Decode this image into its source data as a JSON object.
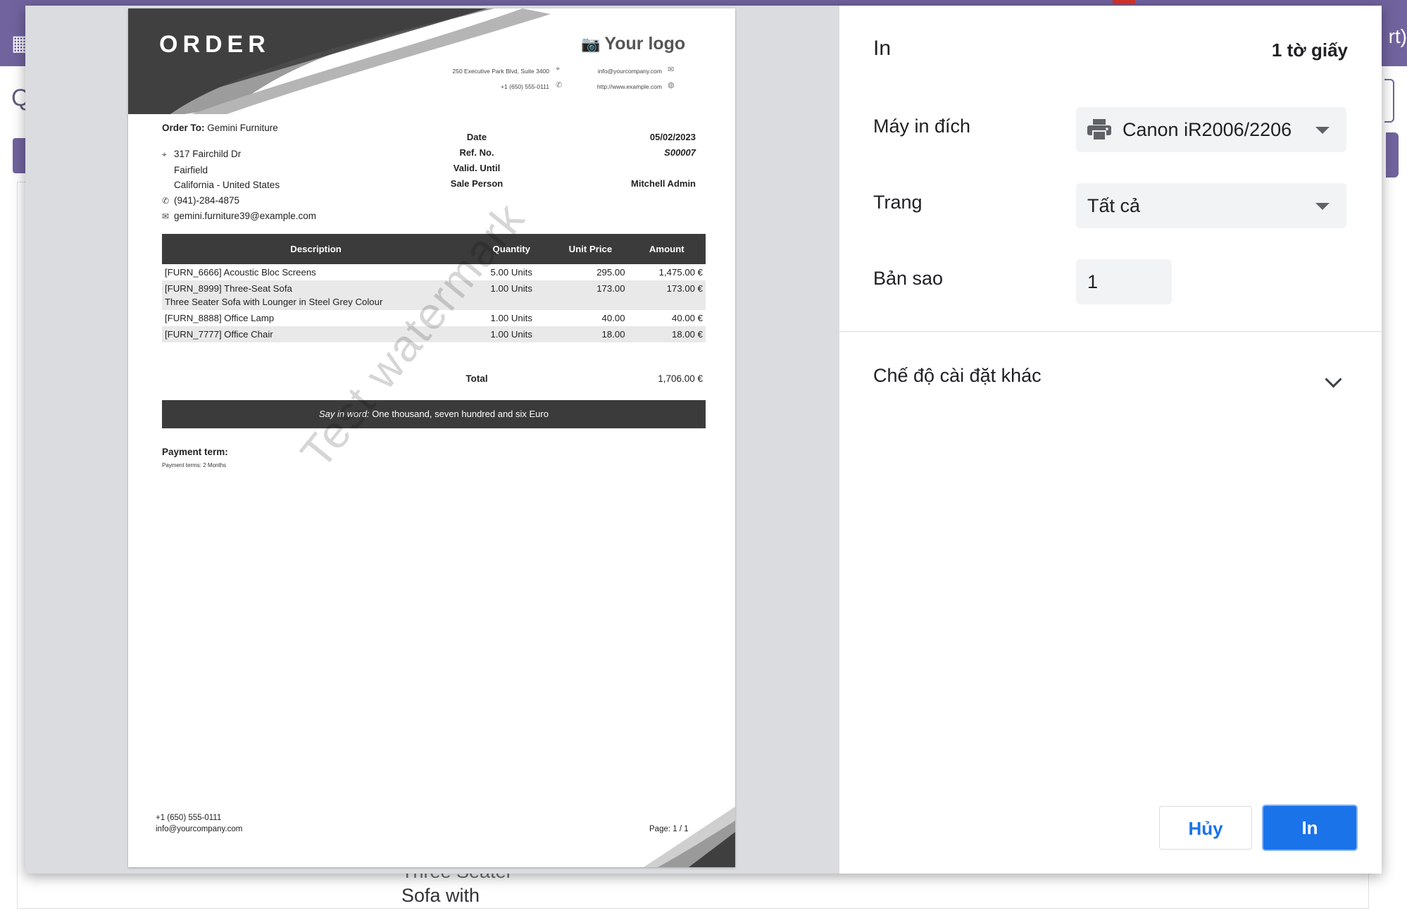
{
  "background": {
    "top_right_text": "rt)",
    "left_letter": "Q",
    "behind_text_line1": "Three Seater",
    "behind_text_line2": "Sofa with"
  },
  "document": {
    "title": "ORDER",
    "logo_text": "Your logo",
    "company": {
      "address": "250 Executive Park Blvd, Suite 3400",
      "phone": "+1 (650) 555-0111",
      "email": "info@yourcompany.com",
      "website": "http://www.example.com"
    },
    "order_to_label": "Order To:",
    "order_to_name": "Gemini Furniture",
    "address_line1": "317 Fairchild Dr",
    "address_line2": "Fairfield",
    "address_line3": "California - United States",
    "phone": "(941)-284-4875",
    "email": "gemini.furniture39@example.com",
    "meta_labels": {
      "date": "Date",
      "ref": "Ref. No.",
      "valid": "Valid. Until",
      "sales": "Sale Person"
    },
    "meta_values": {
      "date": "05/02/2023",
      "ref": "S00007",
      "valid": "",
      "sales": "Mitchell Admin"
    },
    "columns": {
      "description": "Description",
      "quantity": "Quantity",
      "unit_price": "Unit Price",
      "amount": "Amount"
    },
    "lines": [
      {
        "description": "[FURN_6666] Acoustic Bloc Screens",
        "sub": "",
        "quantity": "5.00 Units",
        "unit_price": "295.00",
        "amount": "1,475.00 €"
      },
      {
        "description": "[FURN_8999] Three-Seat Sofa",
        "sub": "Three Seater Sofa with Lounger in Steel Grey Colour",
        "quantity": "1.00 Units",
        "unit_price": "173.00",
        "amount": "173.00 €"
      },
      {
        "description": "[FURN_8888] Office Lamp",
        "sub": "",
        "quantity": "1.00 Units",
        "unit_price": "40.00",
        "amount": "40.00 €"
      },
      {
        "description": "[FURN_7777] Office Chair",
        "sub": "",
        "quantity": "1.00 Units",
        "unit_price": "18.00",
        "amount": "18.00 €"
      }
    ],
    "total_label": "Total",
    "total_value": "1,706.00 €",
    "say_in_word_label": "Say in word:",
    "say_in_word_value": "One thousand, seven hundred and six Euro",
    "payment_term_label": "Payment term:",
    "payment_term_value": "Payment terms: 2 Months",
    "watermark": "Test watermark",
    "footer_phone": "+1 (650) 555-0111",
    "footer_email": "info@yourcompany.com",
    "footer_page": "Page: 1 / 1"
  },
  "print_settings": {
    "title": "In",
    "sheet_count": "1 tờ giấy",
    "destination_label": "Máy in đích",
    "destination_value": "Canon iR2006/2206",
    "pages_label": "Trang",
    "pages_value": "Tất cả",
    "copies_label": "Bản sao",
    "copies_value": "1",
    "more_settings_label": "Chế độ cài đặt khác",
    "cancel_label": "Hủy",
    "print_label": "In"
  },
  "colors": {
    "accent_blue": "#1a73e8",
    "app_purple": "#71639e",
    "document_dark": "#3b3b3b"
  }
}
